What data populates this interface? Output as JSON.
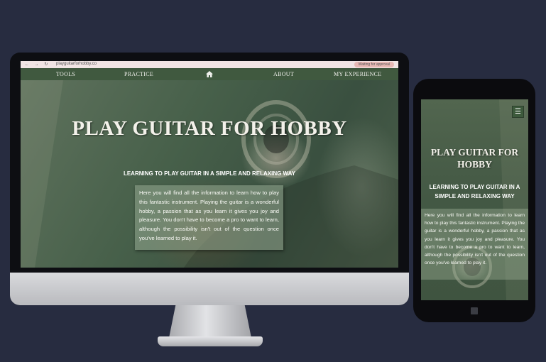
{
  "browser": {
    "url": "playguitarforhobby.co",
    "controls": "← → ↻",
    "badge": "Waiting for approval"
  },
  "nav": {
    "items": [
      "TOOLS",
      "PRACTICE",
      "ABOUT",
      "MY EXPERIENCE"
    ],
    "home_icon": "home-icon"
  },
  "hero": {
    "title": "PLAY GUITAR FOR HOBBY",
    "subtitle": "LEARNING TO PLAY GUITAR IN A SIMPLE AND RELAXING WAY",
    "body": "Here you will find all the information to learn how to play this fantastic instrument. Playing the guitar is a wonderful hobby, a passion that as you learn it gives you joy and pleasure. You don't have to become a pro to want to learn, although the possibility isn't out of the question once you've learned to play it."
  },
  "mobile": {
    "menu_icon": "hamburger-icon",
    "title": "PLAY GUITAR FOR HOBBY",
    "subtitle": "LEARNING TO PLAY GUITAR IN A SIMPLE AND RELAXING WAY",
    "body": "Here you will find all the information to learn how to play this fantastic instrument. Playing the guitar is a wonderful hobby, a passion that as you learn it gives you joy and pleasure. You don't have to become a pro to want to learn, although the possibility isn't out of the question once you've learned to play it."
  },
  "colors": {
    "background": "#272c40",
    "navbar": "#40593f",
    "accent_green": "#3d5a3c"
  }
}
